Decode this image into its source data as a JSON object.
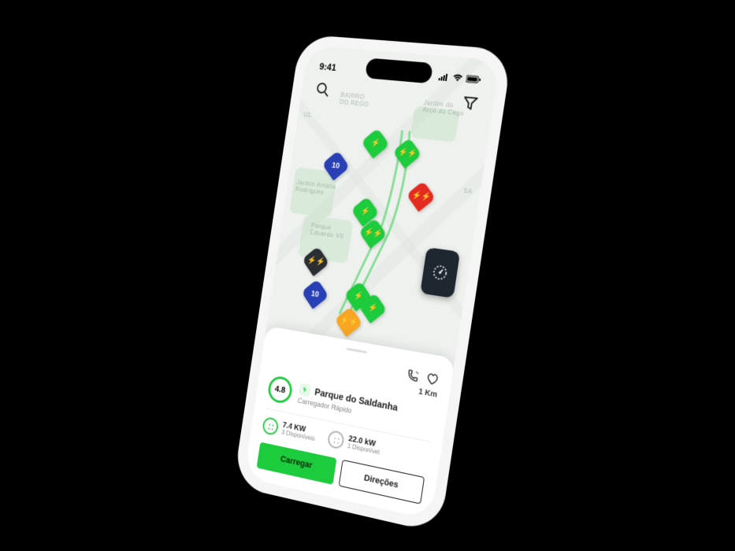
{
  "status_bar": {
    "time": "9:41"
  },
  "map": {
    "labels": {
      "bairro": "BAIRRO\nDO REGO",
      "jardim": "Jardim do\nArco do Cego",
      "amalia": "Jardim Amália\nRodrigues",
      "eduardo": "Parque\nEduardo VII",
      "ul": "UL",
      "sa": "SA"
    },
    "pins": {
      "cluster1_count": "10",
      "cluster2_count": "10"
    }
  },
  "sheet": {
    "distance": "1 Km",
    "rating": "4.8",
    "station_name": "Parque do Saldanha",
    "station_subtitle": "Carregador Rápido",
    "connectors": [
      {
        "power": "7.4 KW",
        "availability": "3 Disponíveis"
      },
      {
        "power": "22.0 kW",
        "availability": "1 Disponível"
      }
    ],
    "charge_label": "Carregar",
    "directions_label": "Direções"
  },
  "colors": {
    "green": "#1dcc3c",
    "blue": "#283fb5",
    "red": "#e32b22",
    "orange": "#f6a623",
    "dark": "#1e2730"
  }
}
